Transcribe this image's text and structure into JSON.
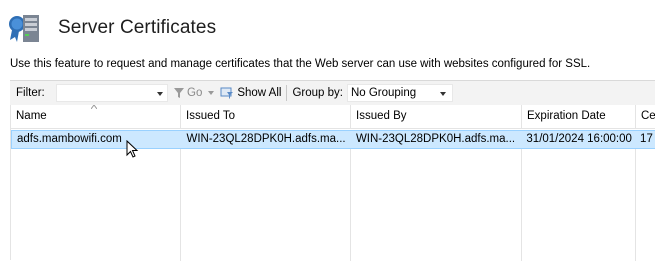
{
  "header": {
    "title": "Server Certificates",
    "icon": "server-certificate-icon"
  },
  "description": "Use this feature to request and manage certificates that the Web server can use with websites configured for SSL.",
  "toolbar": {
    "filter_label": "Filter:",
    "filter_value": "",
    "go_label": "Go",
    "show_all_label": "Show All",
    "group_by_label": "Group by:",
    "group_by_value": "No Grouping"
  },
  "table": {
    "columns": [
      "Name",
      "Issued To",
      "Issued By",
      "Expiration Date",
      "Ce"
    ],
    "rows": [
      {
        "name": "adfs.mambowifi.com",
        "issued_to": "WIN-23QL28DPK0H.adfs.ma...",
        "issued_by": "WIN-23QL28DPK0H.adfs.ma...",
        "expiration_date": "31/01/2024 16:00:00",
        "cert_hash": "17"
      }
    ],
    "selected_row_color": "#cce8ff"
  }
}
